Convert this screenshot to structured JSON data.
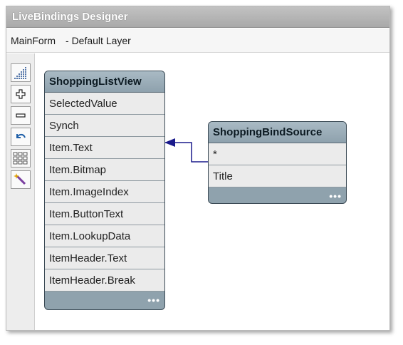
{
  "window": {
    "title": "LiveBindings Designer"
  },
  "layer": {
    "form": "MainForm",
    "layer_name": "- Default Layer"
  },
  "toolbar": {
    "buttons": [
      "zoom-to-fit",
      "zoom-in",
      "zoom-out",
      "undo",
      "arrange",
      "wizard"
    ]
  },
  "components": {
    "listview": {
      "title": "ShoppingListView",
      "members": [
        "SelectedValue",
        "Synch",
        "Item.Text",
        "Item.Bitmap",
        "Item.ImageIndex",
        "Item.ButtonText",
        "Item.LookupData",
        "ItemHeader.Text",
        "ItemHeader.Break"
      ],
      "footer": "•••"
    },
    "bindsource": {
      "title": "ShoppingBindSource",
      "members": [
        "*",
        "Title"
      ],
      "footer": "•••"
    }
  },
  "colors": {
    "component_header": "#8fa2ad",
    "member_bg": "#ebebeb",
    "binding_line": "#1a1a8c"
  }
}
